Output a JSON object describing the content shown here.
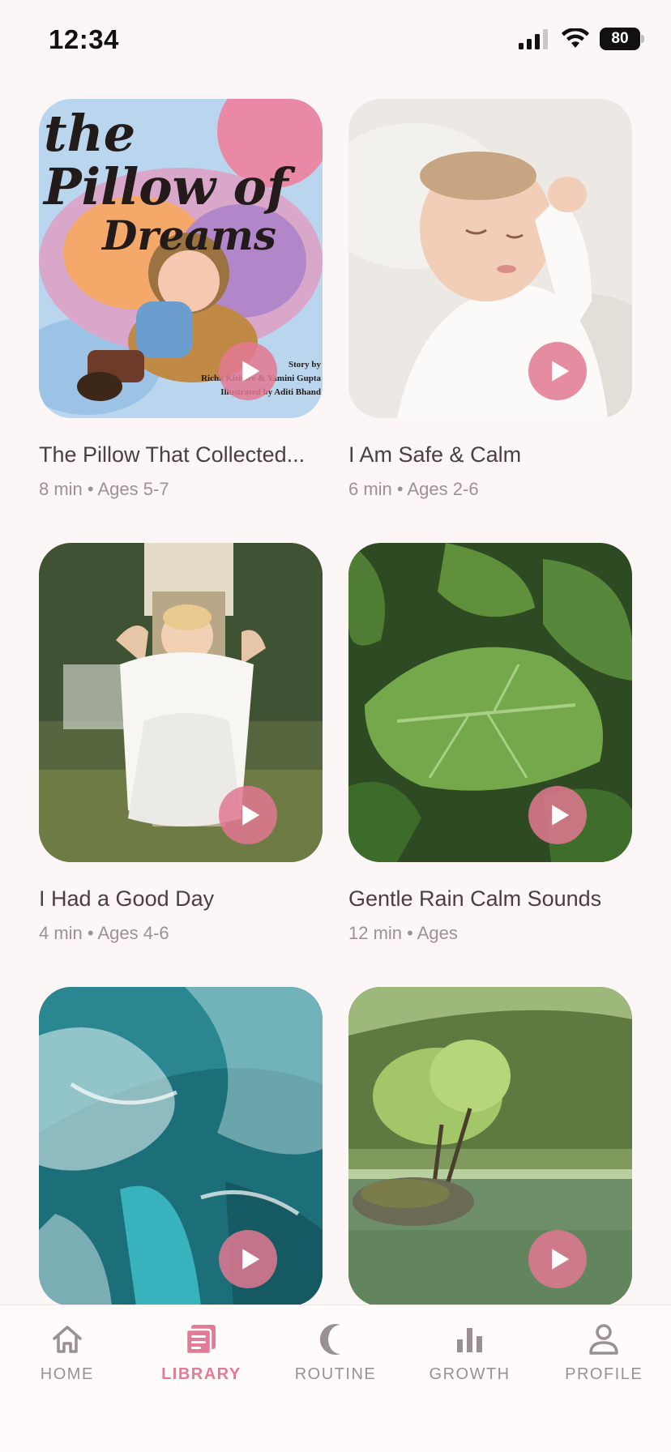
{
  "status_bar": {
    "time": "12:34",
    "battery": "80"
  },
  "cards": [
    {
      "title": "The Pillow That Collected...",
      "meta": "8 min • Ages 5-7",
      "cover": {
        "title_line1": "the Pillow of",
        "title_line2": "Dreams",
        "story_by": "Story by",
        "authors": "Richa Kishore & Yamini Gupta",
        "illustrated": "Illustrated by Aditi Bhand"
      }
    },
    {
      "title": "I Am Safe & Calm",
      "meta": "6 min • Ages 2-6"
    },
    {
      "title": "I Had a Good Day",
      "meta": "4 min • Ages 4-6"
    },
    {
      "title": "Gentle Rain Calm Sounds",
      "meta": "12 min • Ages"
    },
    {
      "title": "",
      "meta": ""
    },
    {
      "title": "",
      "meta": ""
    }
  ],
  "nav": [
    {
      "label": "HOME",
      "icon": "home-icon",
      "active": false
    },
    {
      "label": "LIBRARY",
      "icon": "library-icon",
      "active": true
    },
    {
      "label": "ROUTINE",
      "icon": "moon-icon",
      "active": false
    },
    {
      "label": "GROWTH",
      "icon": "bar-chart-icon",
      "active": false
    },
    {
      "label": "PROFILE",
      "icon": "profile-icon",
      "active": false
    }
  ],
  "colors": {
    "accent": "#e27b96",
    "background": "#fcf6f6",
    "play_button": "#e27892"
  }
}
